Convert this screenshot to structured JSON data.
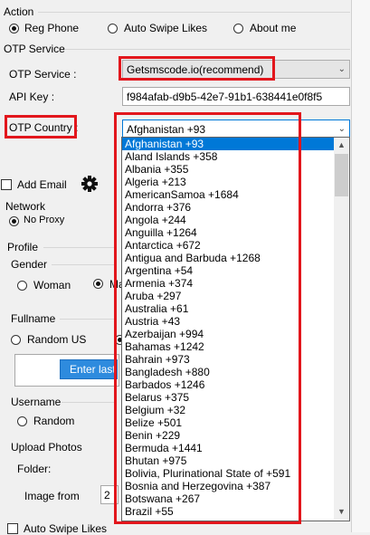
{
  "action": {
    "label": "Action",
    "radios": [
      {
        "label": "Reg Phone",
        "selected": true
      },
      {
        "label": "Auto Swipe Likes",
        "selected": false
      },
      {
        "label": "About me",
        "selected": false
      }
    ]
  },
  "otp_service": {
    "group_label": "OTP Service",
    "field_label": "OTP Service :",
    "value": "Getsmscode.io(recommend)",
    "api_key_label": "API Key :",
    "api_key_value": "f984afab-d9b5-42e7-91b1-638441e0f8f5",
    "country_label": "OTP Country :",
    "country_value": "Afghanistan +93"
  },
  "add_email": {
    "label": "Add Email",
    "checked": false,
    "icon": "gear-icon"
  },
  "network": {
    "label": "Network",
    "option": "No Proxy"
  },
  "profile": {
    "label": "Profile",
    "gender": {
      "label": "Gender",
      "options": [
        "Woman",
        "Ma"
      ]
    },
    "fullname": {
      "label": "Fullname",
      "option": "Random US",
      "button": "Enter last n"
    },
    "username": {
      "label": "Username",
      "option": "Random"
    },
    "upload": {
      "label": "Upload Photos",
      "folder_label": "Folder:",
      "image_from_label": "Image from",
      "image_from_value": "2"
    }
  },
  "bottom": {
    "auto_swipe_label": "Auto Swipe Likes"
  },
  "dropdown": {
    "items": [
      "Afghanistan +93",
      "Aland Islands +358",
      "Albania +355",
      "Algeria +213",
      "AmericanSamoa +1684",
      "Andorra +376",
      "Angola +244",
      "Anguilla +1264",
      "Antarctica +672",
      "Antigua and Barbuda +1268",
      "Argentina +54",
      "Armenia +374",
      "Aruba +297",
      "Australia +61",
      "Austria +43",
      "Azerbaijan +994",
      "Bahamas +1242",
      "Bahrain +973",
      "Bangladesh +880",
      "Barbados +1246",
      "Belarus +375",
      "Belgium +32",
      "Belize +501",
      "Benin +229",
      "Bermuda +1441",
      "Bhutan +975",
      "Bolivia, Plurinational State of +591",
      "Bosnia and Herzegovina +387",
      "Botswana +267",
      "Brazil +55"
    ],
    "selected_index": 0
  }
}
